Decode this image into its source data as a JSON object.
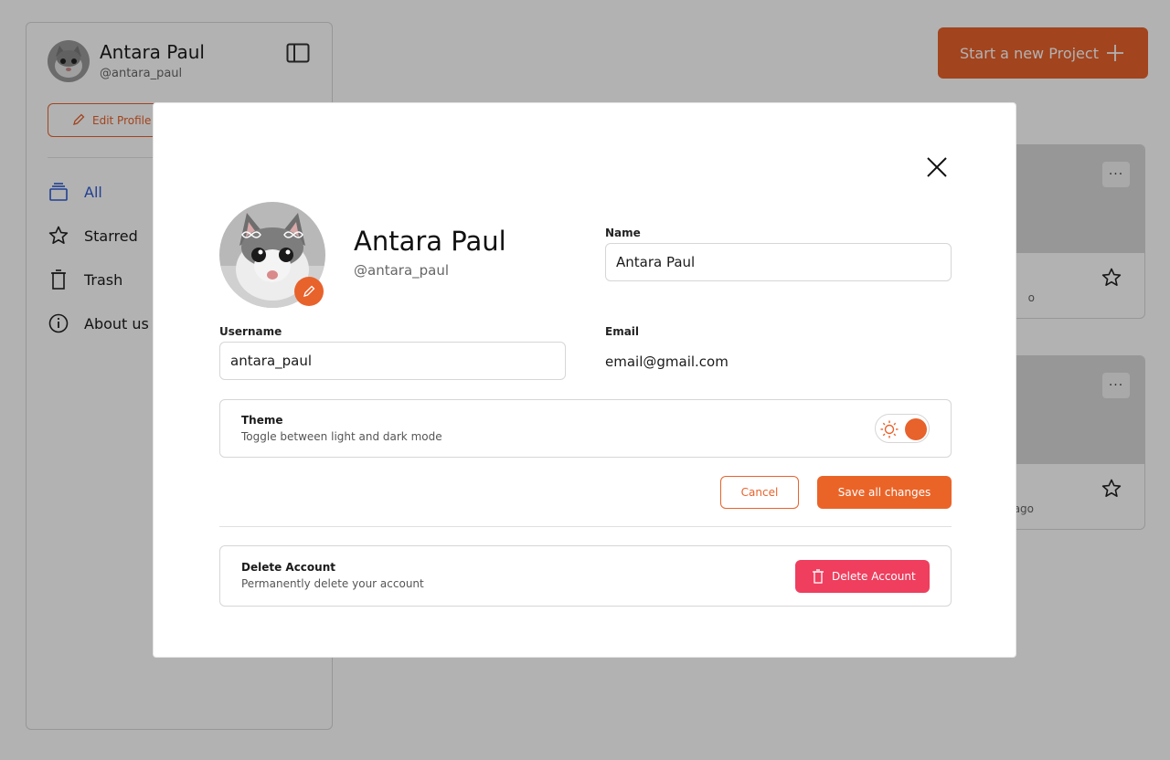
{
  "user": {
    "display_name": "Antara Paul",
    "handle": "@antara_paul"
  },
  "sidebar": {
    "edit_profile_label": "Edit Profile",
    "items": [
      {
        "label": "All",
        "icon": "stack-icon",
        "active": true
      },
      {
        "label": "Starred",
        "icon": "star-icon"
      },
      {
        "label": "Trash",
        "icon": "trash-icon"
      },
      {
        "label": "About us",
        "icon": "info-icon"
      }
    ]
  },
  "header": {
    "new_project_label": "Start a new Project"
  },
  "cards": [
    {
      "meta": "o"
    },
    {
      "meta": "ago"
    }
  ],
  "modal": {
    "name_label": "Name",
    "name_value": "Antara Paul",
    "username_label": "Username",
    "username_value": "antara_paul",
    "email_label": "Email",
    "email_value": "email@gmail.com",
    "theme": {
      "title": "Theme",
      "description": "Toggle between light and dark mode",
      "mode": "light"
    },
    "cancel_label": "Cancel",
    "save_label": "Save all changes",
    "delete": {
      "title": "Delete Account",
      "description": "Permanently delete your account",
      "button_label": "Delete Account"
    }
  },
  "colors": {
    "accent": "#e8622c",
    "danger": "#ef3e5e",
    "active_nav": "#2f5bd3"
  }
}
